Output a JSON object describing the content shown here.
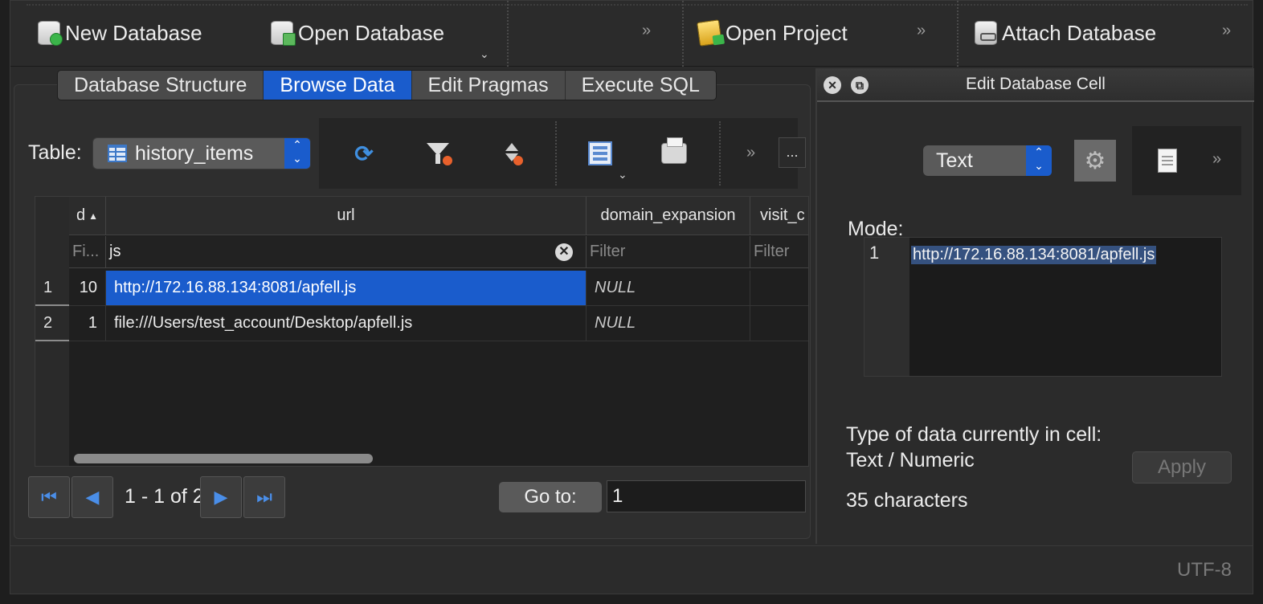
{
  "toolbar": {
    "new_database": "New Database",
    "open_database": "Open Database",
    "open_project": "Open Project",
    "attach_database": "Attach Database",
    "overflow": "»"
  },
  "tabs": [
    "Database Structure",
    "Browse Data",
    "Edit Pragmas",
    "Execute SQL"
  ],
  "active_tab": "Browse Data",
  "browse": {
    "table_label": "Table:",
    "table_name": "history_items",
    "more_button": "...",
    "columns": [
      "d",
      "url",
      "domain_expansion",
      "visit_c"
    ],
    "filters": [
      "Fi...",
      "js",
      "Filter",
      "Filter"
    ],
    "rows": [
      {
        "rownum": "1",
        "d": "10",
        "url": "http://172.16.88.134:8081/apfell.js",
        "domain_expansion": "NULL",
        "visit": ""
      },
      {
        "rownum": "2",
        "d": "1",
        "url": "file:///Users/test_account/Desktop/apfell.js",
        "domain_expansion": "NULL",
        "visit": ""
      }
    ],
    "pager_label": "1 - 1 of 2",
    "goto_label": "Go to:",
    "goto_value": "1"
  },
  "edit_cell": {
    "title": "Edit Database Cell",
    "mode_label": "Mode:",
    "mode_value": "Text",
    "line_number": "1",
    "content": "http://172.16.88.134:8081/apfell.js",
    "type_info": "Type of data currently in cell: Text / Numeric",
    "char_count": "35 characters",
    "apply_label": "Apply"
  },
  "status": {
    "encoding": "UTF-8"
  },
  "colors": {
    "accent": "#1a5ccc",
    "background": "#2b2b2b",
    "selection": "#35517f"
  }
}
